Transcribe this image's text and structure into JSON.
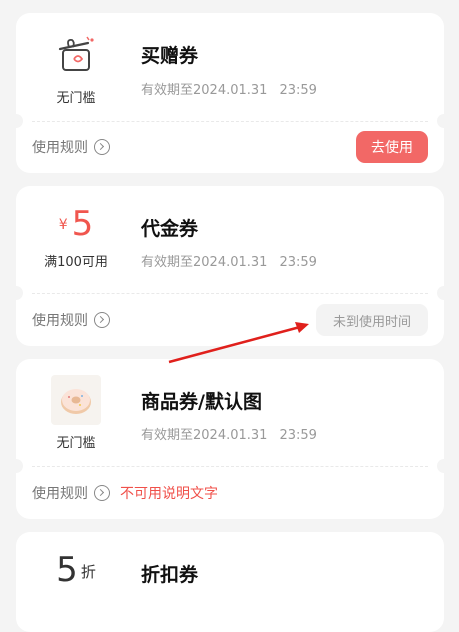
{
  "coupons": [
    {
      "icon": "gift-box-icon",
      "threshold": "无门槛",
      "title": "买赠券",
      "valid_label": "有效期至2024.01.31",
      "valid_time": "23:59",
      "rules_label": "使用规则",
      "action_label": "去使用"
    },
    {
      "currency": "¥",
      "amount": "5",
      "threshold": "满100可用",
      "title": "代金券",
      "valid_label": "有效期至2024.01.31",
      "valid_time": "23:59",
      "rules_label": "使用规则",
      "status_label": "未到使用时间"
    },
    {
      "icon": "donut-image",
      "threshold": "无门槛",
      "title": "商品券/默认图",
      "valid_label": "有效期至2024.01.31",
      "valid_time": "23:59",
      "rules_label": "使用规则",
      "unavailable_text": "不可用说明文字"
    },
    {
      "discount_value": "5",
      "discount_unit": "折",
      "title": "折扣券"
    }
  ],
  "colors": {
    "accent": "#f26866",
    "unavailable": "#f0504a",
    "annotation_arrow": "#e0201c"
  }
}
